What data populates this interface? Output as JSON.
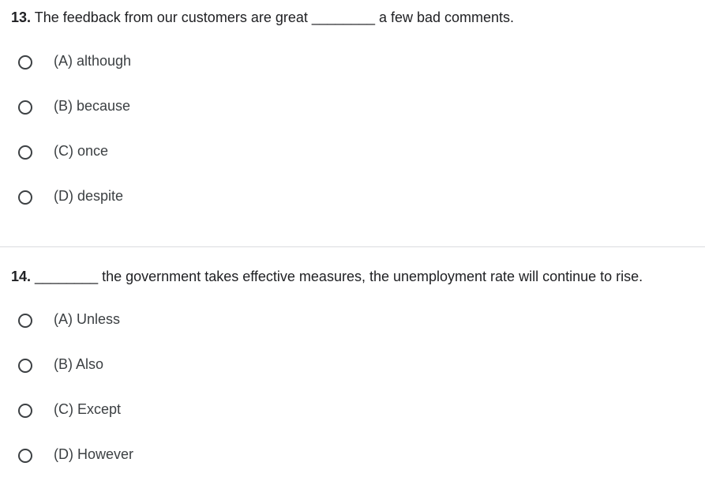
{
  "questions": [
    {
      "number": "13.",
      "text": " The feedback from our customers are great ________ a few bad comments.",
      "options": [
        "(A) although",
        "(B) because",
        "(C) once",
        "(D) despite"
      ]
    },
    {
      "number": "14.",
      "text": " ________ the government takes effective measures, the unemployment rate will continue to rise.",
      "options": [
        "(A) Unless",
        "(B) Also",
        "(C) Except",
        "(D) However"
      ]
    }
  ],
  "colors": {
    "text": "#202124",
    "option_text": "#3c4043",
    "radio_border": "#3c4043",
    "divider": "#dadce0"
  },
  "icons": {
    "radio": "radio-button-unchecked-icon"
  }
}
